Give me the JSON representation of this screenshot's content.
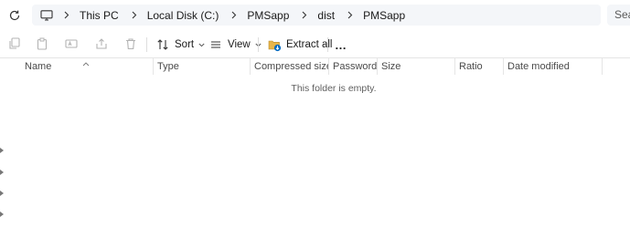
{
  "breadcrumbs": [
    "This PC",
    "Local Disk (C:)",
    "PMSapp",
    "dist",
    "PMSapp"
  ],
  "search": {
    "placeholder": "Search"
  },
  "toolbar": {
    "sort_label": "Sort",
    "view_label": "View",
    "extract_label": "Extract all",
    "more_label": "…"
  },
  "columns": [
    "Name",
    "Type",
    "Compressed size",
    "Password p...",
    "Size",
    "Ratio",
    "Date modified"
  ],
  "empty_message": "This folder is empty.",
  "colors": {
    "accent": "#0067c0",
    "address_bg": "#f4f6f9",
    "icon_gray": "#b3b3b3"
  }
}
